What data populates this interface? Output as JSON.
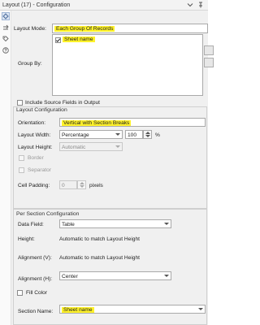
{
  "window": {
    "title": "Layout (17) - Configuration"
  },
  "layout_mode": {
    "label": "Layout Mode:",
    "value": "Each Group Of Records"
  },
  "group_by": {
    "label": "Group By:",
    "items": [
      {
        "label": "Sheet name",
        "checked": true
      }
    ]
  },
  "include_source_fields": {
    "label": "Include Source Fields in Output",
    "checked": false
  },
  "layout_configuration": {
    "title": "Layout Configuration",
    "orientation": {
      "label": "Orientation:",
      "value": "Vertical with Section Breaks"
    },
    "layout_width": {
      "label": "Layout Width:",
      "value": "Percentage",
      "number": "100",
      "unit": "%"
    },
    "layout_height": {
      "label": "Layout Height:",
      "value": "Automatic"
    },
    "border": {
      "label": "Border",
      "checked": false
    },
    "separator": {
      "label": "Separator",
      "checked": false
    },
    "cell_padding": {
      "label": "Cell Padding:",
      "value": "0",
      "unit": "pixels"
    }
  },
  "per_section": {
    "title": "Per Section Configuration",
    "data_field": {
      "label": "Data Field:",
      "value": "Table"
    },
    "height": {
      "label": "Height:",
      "value": "Automatic to match Layout Height"
    },
    "alignment_v": {
      "label": "Alignment (V):",
      "value": "Automatic to match Layout Height"
    },
    "alignment_h": {
      "label": "Alignment (H):",
      "value": "Center"
    },
    "fill_color": {
      "label": "Fill Color",
      "checked": false
    },
    "section_name": {
      "label": "Section Name:",
      "value": "Sheet name"
    }
  },
  "highlight_color": "#fff22a"
}
